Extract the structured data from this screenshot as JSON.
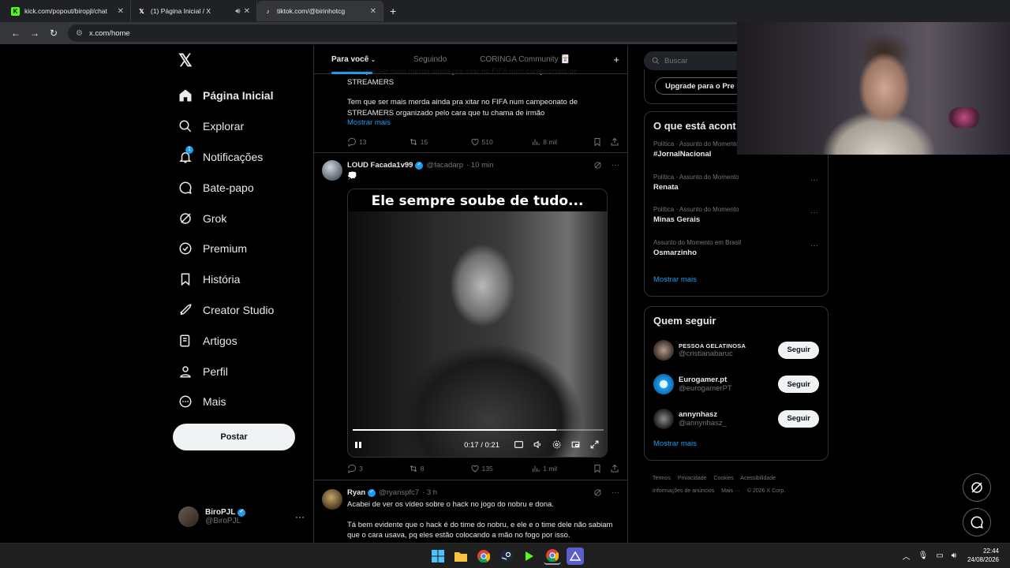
{
  "browser": {
    "tabs": [
      {
        "title": "kick.com/popout/biropjl/chat",
        "favicon": "kick-icon",
        "color": "#53fc18",
        "active": false
      },
      {
        "title": "(1) Página Inicial / X",
        "favicon": "x-icon",
        "color": "#ffffff",
        "active": false,
        "audio": true
      },
      {
        "title": "tiktok.com/@birinhotcg",
        "favicon": "tiktok-icon",
        "color": "#ffffff",
        "active": true
      }
    ],
    "url": "x.com/home"
  },
  "sidebar": {
    "items": [
      {
        "label": "Página Inicial",
        "icon": "home-icon"
      },
      {
        "label": "Explorar",
        "icon": "search-icon"
      },
      {
        "label": "Notificações",
        "icon": "bell-icon",
        "badge": "1"
      },
      {
        "label": "Bate-papo",
        "icon": "chat-icon"
      },
      {
        "label": "Grok",
        "icon": "grok-icon"
      },
      {
        "label": "Premium",
        "icon": "premium-icon"
      },
      {
        "label": "História",
        "icon": "bookmark-icon"
      },
      {
        "label": "Creator Studio",
        "icon": "rocket-icon"
      },
      {
        "label": "Artigos",
        "icon": "article-icon"
      },
      {
        "label": "Perfil",
        "icon": "person-icon"
      },
      {
        "label": "Mais",
        "icon": "more-circle-icon"
      }
    ],
    "post_button": "Postar",
    "profile": {
      "name": "BiroPJL",
      "handle": "@BiroPJL"
    }
  },
  "feed": {
    "tabs": [
      "Para você",
      "Seguindo",
      "CORINGA Community 🃏"
    ],
    "post1": {
      "text_top": "Tem que ser mais merda ainda pra xitar no FIFA num campeonato de STREAMERS",
      "text_body": "Tem que ser mais merda ainda pra xitar no FIFA num campeonato de STREAMERS organizado pelo cara que tu chama de irmão",
      "show_more": "Mostrar mais",
      "replies": "13",
      "reposts": "15",
      "likes": "510",
      "views": "8 mil"
    },
    "post2": {
      "name": "LOUD Facada1v99",
      "handle": "@facadarp",
      "time": "· 10 min",
      "emoji": "💭",
      "video_caption": "Ele sempre soube de tudo...",
      "video_time": "0:17 / 0:21",
      "progress": 0.81,
      "replies": "3",
      "reposts": "8",
      "likes": "135",
      "views": "1 mil"
    },
    "post3": {
      "name": "Ryan",
      "handle": "@ryanspfc7",
      "time": "· 3 h",
      "line1": "Acabei de ver os vídeo sobre o hack no jogo do nobru e dona.",
      "line2": "Tá bem evidente que o hack é do time do nobru, e ele e o time dele não sabiam que o cara usava, pq eles estão colocando a mão no fogo por isso."
    }
  },
  "right": {
    "search_placeholder": "Buscar",
    "upgrade": "Upgrade para o Pre",
    "trends_title": "O que está acont",
    "trends": [
      {
        "category": "Política · Assunto do Momento",
        "name": "#JornalNacional"
      },
      {
        "category": "Política · Assunto do Momento",
        "name": "Renata"
      },
      {
        "category": "Política · Assunto do Momento",
        "name": "Minas Gerais"
      },
      {
        "category": "Assunto do Momento em Brasil",
        "name": "Osmarzinho"
      }
    ],
    "show_more": "Mostrar mais",
    "follow_title": "Quem seguir",
    "follow": [
      {
        "name": "PESSOA GELATINOSA",
        "handle": "@cristianabaruc",
        "button": "Seguir"
      },
      {
        "name": "Eurogamer.pt",
        "handle": "@eurogamerPT",
        "button": "Seguir"
      },
      {
        "name": "annynhasz",
        "handle": "@annynhasz_",
        "button": "Seguir"
      }
    ],
    "follow_more": "Mostrar mais",
    "footer": [
      "Termos",
      "Privacidade",
      "Cookies",
      "Acessibilidade",
      "Informações de anúncios",
      "Mais ···",
      "© 2026 X Corp."
    ]
  },
  "taskbar": {
    "time": "22:44",
    "date": "24/08/2026",
    "apps": [
      "windows-start-icon",
      "file-explorer-icon",
      "chrome-icon",
      "steam-icon",
      "kick-app-icon",
      "chrome-alt-icon",
      "app-icon"
    ]
  },
  "colors": {
    "accent": "#1d9bf0",
    "bg": "#000000",
    "border": "#2f3336",
    "muted": "#71767b"
  }
}
